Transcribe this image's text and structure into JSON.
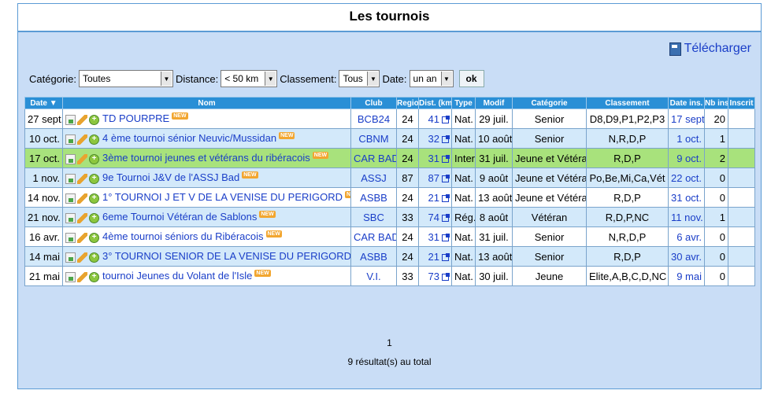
{
  "title": "Les tournois",
  "download_label": "Télécharger",
  "filters": {
    "categorie_label": "Catégorie:",
    "categorie_value": "Toutes",
    "distance_label": "Distance:",
    "distance_value": "< 50 km",
    "classement_label": "Classement:",
    "classement_value": "Tous",
    "date_label": "Date:",
    "date_value": "un an",
    "ok_label": "ok"
  },
  "columns": [
    "Date ▼",
    "Nom",
    "Club",
    "Region",
    "Dist. (km)",
    "Type",
    "Modif",
    "Catégorie",
    "Classement",
    "Date ins.",
    "Nb ins.",
    "Inscrit"
  ],
  "new_badge": "NEW",
  "rows": [
    {
      "date": "27 sept.",
      "nom": "TD POURPRE",
      "club": "BCB24",
      "region": "24",
      "dist": "41",
      "type": "Nat.",
      "modif": "29 juil.",
      "categorie": "Senior",
      "classement": "D8,D9,P1,P2,P3",
      "date_ins": "17 sept.",
      "nb_ins": "20",
      "style": "odd"
    },
    {
      "date": "10 oct.",
      "nom": "4 ème tournoi sénior Neuvic/Mussidan",
      "club": "CBNM",
      "region": "24",
      "dist": "32",
      "type": "Nat.",
      "modif": "10 août",
      "categorie": "Senior",
      "classement": "N,R,D,P",
      "date_ins": "1 oct.",
      "nb_ins": "1",
      "style": "even"
    },
    {
      "date": "17 oct.",
      "nom": "3ème tournoi jeunes et vétérans du ribéracois",
      "club": "CAR BAD",
      "region": "24",
      "dist": "31",
      "type": "Inter",
      "modif": "31 juil.",
      "categorie": "Jeune et Vétéran",
      "classement": "R,D,P",
      "date_ins": "9 oct.",
      "nb_ins": "2",
      "style": "hl"
    },
    {
      "date": "1 nov.",
      "nom": "9e Tournoi J&V de l'ASSJ Bad",
      "club": "ASSJ",
      "region": "87",
      "dist": "87",
      "type": "Nat.",
      "modif": "9 août",
      "categorie": "Jeune et Vétéran",
      "classement": "Po,Be,Mi,Ca,Vét",
      "date_ins": "22 oct.",
      "nb_ins": "0",
      "style": "even"
    },
    {
      "date": "14 nov.",
      "nom": "1° TOURNOI J ET V DE LA VENISE DU PERIGORD",
      "club": "ASBB",
      "region": "24",
      "dist": "21",
      "type": "Nat.",
      "modif": "13 août",
      "categorie": "Jeune et Vétéran",
      "classement": "R,D,P",
      "date_ins": "31 oct.",
      "nb_ins": "0",
      "style": "odd"
    },
    {
      "date": "21 nov.",
      "nom": "6eme Tournoi Vétéran de Sablons",
      "club": "SBC",
      "region": "33",
      "dist": "74",
      "type": "Rég.",
      "modif": "8 août",
      "categorie": "Vétéran",
      "classement": "R,D,P,NC",
      "date_ins": "11 nov.",
      "nb_ins": "1",
      "style": "even"
    },
    {
      "date": "16 avr.",
      "nom": "4ème tournoi séniors du Ribéracois",
      "club": "CAR BAD",
      "region": "24",
      "dist": "31",
      "type": "Nat.",
      "modif": "31 juil.",
      "categorie": "Senior",
      "classement": "N,R,D,P",
      "date_ins": "6 avr.",
      "nb_ins": "0",
      "style": "odd"
    },
    {
      "date": "14 mai",
      "nom": "3° TOURNOI SENIOR DE LA VENISE DU PERIGORD",
      "club": "ASBB",
      "region": "24",
      "dist": "21",
      "type": "Nat.",
      "modif": "13 août",
      "categorie": "Senior",
      "classement": "R,D,P",
      "date_ins": "30 avr.",
      "nb_ins": "0",
      "style": "even"
    },
    {
      "date": "21 mai",
      "nom": "tournoi Jeunes du Volant de l'Isle",
      "club": "V.I.",
      "region": "33",
      "dist": "73",
      "type": "Nat.",
      "modif": "30 juil.",
      "categorie": "Jeune",
      "classement": "Elite,A,B,C,D,NC",
      "date_ins": "9 mai",
      "nb_ins": "0",
      "style": "odd"
    }
  ],
  "pagination": "1",
  "total": "9 résultat(s) au total",
  "colors": {
    "header": "#2a8fd6",
    "panel": "#c9ddf6",
    "highlight": "#a8e27c",
    "even": "#d3e9fa",
    "link": "#1a3ec8"
  }
}
